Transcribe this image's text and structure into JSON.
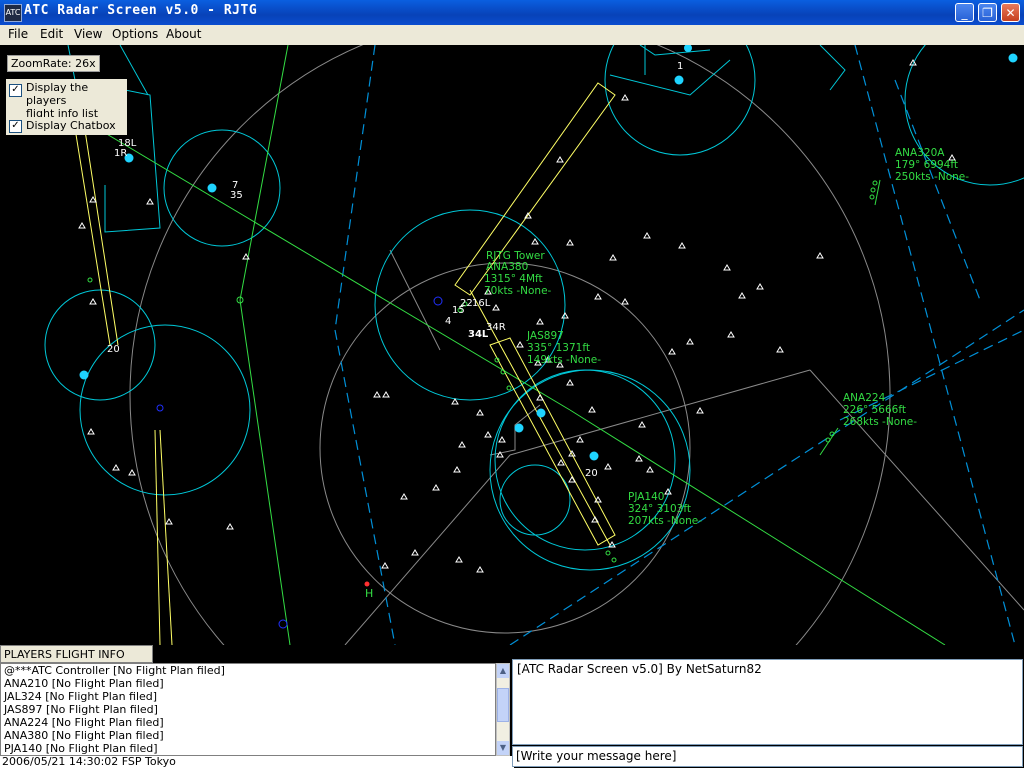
{
  "window": {
    "title": "ATC Radar Screen v5.0 - RJTG",
    "icon": "atc-app-icon"
  },
  "menu": [
    "File",
    "Edit",
    "View",
    "Options",
    "About"
  ],
  "overlay": {
    "zoom": "ZoomRate: 26x",
    "display_players_label": "Display the players flight info list",
    "display_players_line1": "Display the players",
    "display_players_line2": "flight info list",
    "display_players_checked": true,
    "display_chatbox_label": "Display Chatbox",
    "display_chatbox_checked": true
  },
  "radar": {
    "runway_labels": [
      "18L",
      "1R",
      "7",
      "35",
      "20",
      "15",
      "4",
      "34L",
      "34R",
      "22",
      "16L",
      "1",
      "20"
    ],
    "aircraft": [
      {
        "callsign": "RJTG Tower",
        "line2": "ANA380",
        "line3": "",
        "line4": ""
      },
      {
        "callsign": "JAS897",
        "line2": "335°  1371ft",
        "line3": "149kts -None-"
      },
      {
        "callsign": "ANA320A",
        "line2": "179°  6994ft",
        "line3": "250kts -None-"
      },
      {
        "callsign": "ANA224",
        "line2": "226°  5666ft",
        "line3": "268kts -None-"
      },
      {
        "callsign": "PJA140",
        "line2": "324°  3103ft",
        "line3": "207kts -None-"
      }
    ],
    "colors": {
      "background": "#000000",
      "circle": "#00c8d8",
      "beacon": "#1fd4ff",
      "tag": "#33dd44",
      "runway": "#ffff66",
      "route": "#44ee44",
      "dash": "#00a8e8"
    }
  },
  "players_list": {
    "header": "PLAYERS FLIGHT INFO LIST:",
    "rows": [
      "@***ATC Controller   [No Flight Plan filed]",
      "ANA210   [No Flight Plan filed]",
      "JAL324   [No Flight Plan filed]",
      "JAS897   [No Flight Plan filed]",
      "ANA224   [No Flight Plan filed]",
      "ANA380   [No Flight Plan filed]",
      "PJA140   [No Flight Plan filed]"
    ],
    "status": "2006/05/21 14:30:02  FSP  Tokyo"
  },
  "chat": {
    "log": "[ATC Radar Screen v5.0] By NetSaturn82",
    "input_value": "[Write your message here]"
  }
}
